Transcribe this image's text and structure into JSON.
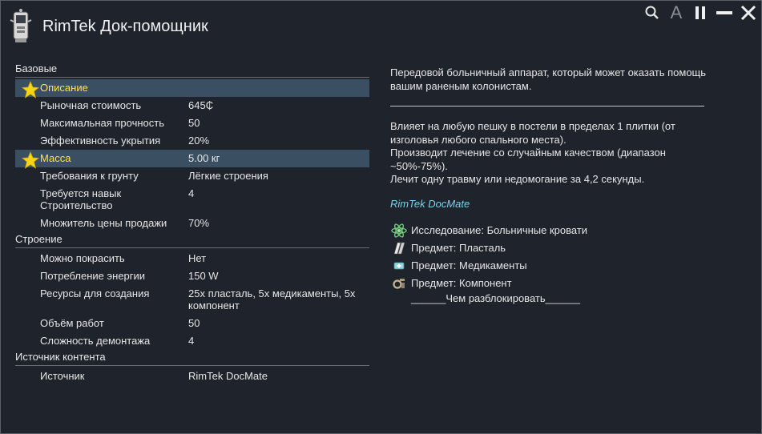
{
  "window": {
    "title": "RimTek Док-помощник"
  },
  "sections": [
    {
      "header": "Базовые",
      "rows": [
        {
          "label": "Описание",
          "value": "",
          "highlight": true,
          "star": true
        },
        {
          "label": "Рыночная стоимость",
          "value": "645₵"
        },
        {
          "label": "Максимальная прочность",
          "value": "50"
        },
        {
          "label": "Эффективность укрытия",
          "value": "20%"
        },
        {
          "label": "Масса",
          "value": "5.00 кг",
          "highlight": true,
          "star": true
        },
        {
          "label": "Требования к грунту",
          "value": "Лёгкие строения"
        },
        {
          "label": "Требуется навык Строительство",
          "value": "4"
        },
        {
          "label": "Множитель цены продажи",
          "value": "70%"
        }
      ]
    },
    {
      "header": "Строение",
      "rows": [
        {
          "label": "Можно покрасить",
          "value": "Нет"
        },
        {
          "label": "Потребление энергии",
          "value": "150 W"
        },
        {
          "label": "Ресурсы для создания",
          "value": "25x пласталь, 5x медикаменты, 5x компонент"
        },
        {
          "label": "Объём работ",
          "value": "50"
        },
        {
          "label": "Сложность демонтажа",
          "value": "4"
        }
      ]
    },
    {
      "header": "Источник контента",
      "rows": [
        {
          "label": "Источник",
          "value": "RimTek DocMate"
        }
      ]
    }
  ],
  "description": {
    "intro": "Передовой больничный аппарат, который может оказать помощь вашим раненым колонистам.",
    "effects": [
      " Влияет на любую пешку в постели в пределах 1 плитки (от изголовья любого спального места).",
      " Производит лечение со случайным качеством (диапазон ~50%-75%).",
      " Лечит одну травму или недомогание за 4,2 секунды."
    ],
    "source": "RimTek DocMate",
    "requirements": [
      {
        "icon": "research-atom-icon",
        "text": "Исследование: Больничные кровати"
      },
      {
        "icon": "plasteel-icon",
        "text": "Предмет: Пласталь"
      },
      {
        "icon": "medicine-icon",
        "text": "Предмет: Медикаменты"
      },
      {
        "icon": "component-icon",
        "text": "Предмет: Компонент"
      }
    ],
    "unlock_label": "______Чем разблокировать______"
  },
  "colors": {
    "background": "#1f232b",
    "highlight_row": "#3b4f63",
    "highlight_text": "#ffe34a",
    "source_link": "#7fd0e8"
  },
  "toolbar_icons": [
    "search-icon",
    "text-size-icon",
    "pause-icon",
    "minimize-icon",
    "close-icon"
  ]
}
